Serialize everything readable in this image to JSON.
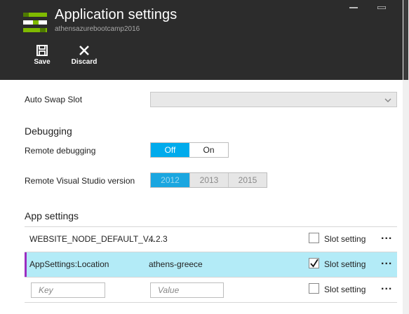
{
  "header": {
    "title": "Application settings",
    "subtitle": "athensazurebootcamp2016",
    "save_label": "Save",
    "discard_label": "Discard",
    "background": "#2c2c2c"
  },
  "general": {
    "auto_swap_label": "Auto Swap Slot",
    "auto_swap_value": ""
  },
  "debugging": {
    "heading": "Debugging",
    "remote_debugging_label": "Remote debugging",
    "remote_debugging_options": [
      "Off",
      "On"
    ],
    "remote_debugging_selected": "Off",
    "vs_version_label": "Remote Visual Studio version",
    "vs_versions": [
      "2012",
      "2013",
      "2015"
    ],
    "vs_selected": "2012"
  },
  "app_settings": {
    "heading": "App settings",
    "slot_setting_label": "Slot setting",
    "more_label": "...",
    "rows": [
      {
        "key": "WEBSITE_NODE_DEFAULT_V...",
        "value": "4.2.3",
        "slot_setting": false
      },
      {
        "key": "AppSettings:Location",
        "value": "athens-greece",
        "slot_setting": true
      }
    ],
    "new_row": {
      "key_placeholder": "Key",
      "value_placeholder": "Value",
      "slot_setting": false
    }
  },
  "colors": {
    "accent": "#00abec",
    "row_highlight": "#b3ebf7",
    "row_marker": "#9b2ec1"
  }
}
